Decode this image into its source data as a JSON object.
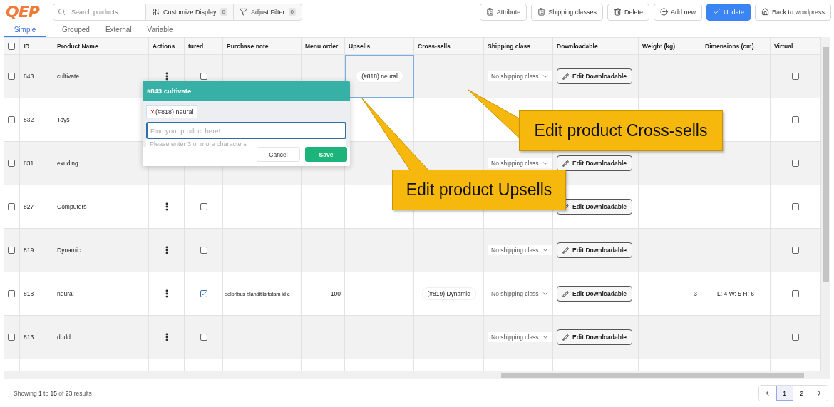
{
  "logo": "QEP",
  "toolbar": {
    "search": {
      "placeholder": "Search products"
    },
    "filters": [
      {
        "kind": "sliders",
        "label": "Customize Display",
        "count": "0"
      },
      {
        "kind": "filter",
        "label": "Adjust Filter",
        "count": "0"
      }
    ],
    "actions": [
      {
        "kind": "clipboard",
        "label": "Attribute",
        "primary": false
      },
      {
        "kind": "clipboard",
        "label": "Shipping classes",
        "primary": false
      },
      {
        "kind": "trash",
        "label": "Delete",
        "primary": false
      },
      {
        "kind": "add",
        "label": "Add new",
        "primary": false
      },
      {
        "kind": "check",
        "label": "Update",
        "primary": true
      },
      {
        "kind": "home",
        "label": "Back to wordpress",
        "primary": false
      }
    ]
  },
  "tabs": [
    {
      "label": "Simple",
      "selected": true
    },
    {
      "label": "Grouped",
      "selected": false
    },
    {
      "label": "External",
      "selected": false
    },
    {
      "label": "Variable",
      "selected": false
    }
  ],
  "table": {
    "select_all": {
      "checked": false
    },
    "columns": [
      "ID",
      "Product Name",
      "Actions",
      "tured",
      "Purchase note",
      "Menu order",
      "Upsells",
      "Cross-sells",
      "Shipping class",
      "Downloadable",
      "Weight (kg)",
      "Dimensions (cm)",
      "Virtual"
    ],
    "rows": [
      {
        "checked": false,
        "id": "843",
        "name": "cultivate",
        "featured": false,
        "upsells": "(#818) neural",
        "upsells_editing": true,
        "shipping": "No shipping class",
        "downloadable": "Edit Downloadable",
        "virtual": false
      },
      {
        "checked": false,
        "id": "832",
        "name": "Toys",
        "virtual": false
      },
      {
        "checked": false,
        "id": "831",
        "name": "exuding",
        "shipping": "No shipping class",
        "downloadable": "Edit Downloadable",
        "virtual": false
      },
      {
        "checked": false,
        "id": "827",
        "name": "Computers",
        "featured": false,
        "downloadable": "Edit Downloadable",
        "virtual": false
      },
      {
        "checked": false,
        "id": "819",
        "name": "Dynamic",
        "featured": false,
        "shipping": "No shipping class",
        "downloadable": "Edit Downloadable",
        "virtual": false
      },
      {
        "checked": false,
        "id": "818",
        "name": "neural",
        "featured": true,
        "note": "doloribus blanditiis totam id e",
        "menu_order": "100",
        "cross_sells": "(#819) Dynamic",
        "shipping": "No shipping class",
        "downloadable": "Edit Downloadable",
        "weight": "3",
        "dimensions": "L: 4 W: 5 H: 6",
        "virtual": false
      },
      {
        "checked": false,
        "id": "813",
        "name": "dddd",
        "featured": false,
        "shipping": "No shipping class",
        "downloadable": "Edit Downloadable",
        "virtual": false
      }
    ]
  },
  "popup": {
    "title": "#843 cultivate",
    "tags": [
      "(#818) neural"
    ],
    "search": {
      "placeholder": "Find your product here!"
    },
    "hint": "Please enter 3 or more characters",
    "buttons": [
      {
        "label": "Cancel",
        "primary": false
      },
      {
        "label": "Save",
        "primary": true
      }
    ]
  },
  "callouts": [
    {
      "text": "Edit product Cross-sells"
    },
    {
      "text": "Edit product Upsells"
    }
  ],
  "footer": {
    "summary": "Showing **1** to **15** of **23** results",
    "pages": [
      {
        "label": "1",
        "selected": true
      },
      {
        "label": "2",
        "selected": false
      }
    ]
  }
}
